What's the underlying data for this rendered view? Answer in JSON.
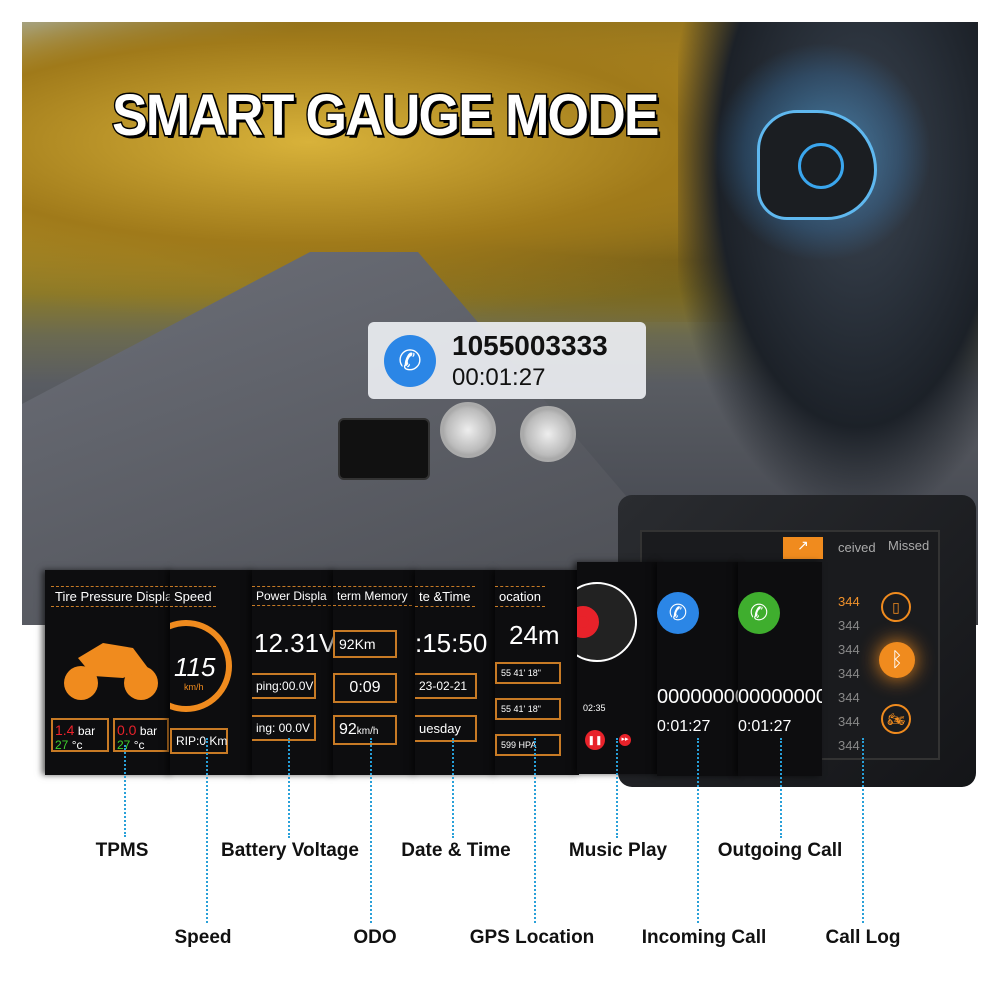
{
  "headline": "SMART GAUGE MODE",
  "call_bubble": {
    "icon": "incoming-call-icon",
    "number": "1055003333",
    "duration": "00:01:27"
  },
  "panels": {
    "tpms": {
      "title": "Tire Pressure Display",
      "front": {
        "value": "1.4",
        "unit": "bar",
        "temp": "27",
        "temp_unit": "°c"
      },
      "rear": {
        "value": "0.0",
        "unit": "bar",
        "temp": "27",
        "temp_unit": "°c"
      }
    },
    "speed": {
      "title": "Speed",
      "value": "115",
      "unit": "km/h",
      "trip": "RIP:0 Km"
    },
    "battery": {
      "title": "Power Displa",
      "voltage": "12.31V",
      "line1": "ping:00.0V",
      "line2": "ing: 00.0V"
    },
    "odo": {
      "title": "term Memory",
      "distance": "92Km",
      "time": "0:09",
      "speed": "92",
      "speed_unit": "km/h"
    },
    "datetime": {
      "title": "te &Time",
      "time": ":15:50",
      "date": "23-02-21",
      "day": "uesday"
    },
    "gps": {
      "title": "ocation",
      "altitude": "24m",
      "lat": "55  41'  18\"",
      "lon": "55  41'  18\"",
      "pressure": "599 HPA"
    },
    "music": {
      "elapsed": "02:35"
    },
    "incoming": {
      "number": "00000000",
      "duration": "0:01:27"
    },
    "outgoing": {
      "number": "00000000",
      "duration": "0:01:27"
    },
    "call_log": {
      "headers": [
        "ceived",
        "Missed"
      ],
      "entries": [
        "344",
        "344",
        "344",
        "344",
        "344",
        "344",
        "344"
      ]
    }
  },
  "labels": {
    "tpms": "TPMS",
    "speed": "Speed",
    "battery": "Battery Voltage",
    "odo": "ODO",
    "datetime": "Date & Time",
    "gps": "GPS Location",
    "music": "Music Play",
    "incoming": "Incoming Call",
    "outgoing": "Outgoing Call",
    "call_log": "Call Log"
  },
  "colors": {
    "accent": "#f08b1e",
    "incoming": "#2b86e6",
    "outgoing": "#3fae2e",
    "leader": "#2aa0d8",
    "alert": "#e8222a"
  }
}
